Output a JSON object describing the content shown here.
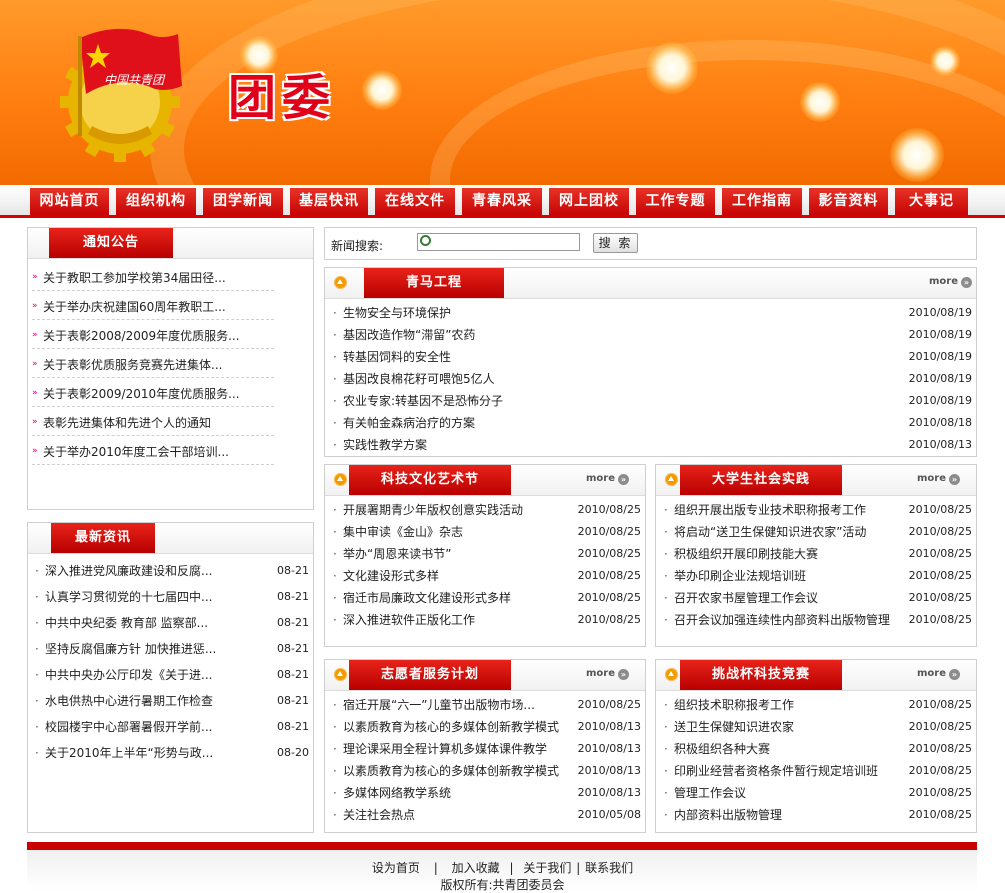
{
  "header": {
    "site_title": "团委"
  },
  "nav": [
    "网站首页",
    "组织机构",
    "团学新闻",
    "基层快讯",
    "在线文件",
    "青春风采",
    "网上团校",
    "工作专题",
    "工作指南",
    "影音资料",
    "大事记"
  ],
  "notice": {
    "title": "通知公告",
    "items": [
      "关于教职工参加学校第34届田径...",
      "关于举办庆祝建国60周年教职工...",
      "关于表彰2008/2009年度优质服务...",
      "关于表彰优质服务竞赛先进集体...",
      "关于表彰2009/2010年度优质服务...",
      "表彰先进集体和先进个人的通知",
      "关于举办2010年度工会干部培训..."
    ]
  },
  "latest": {
    "title": "最新资讯",
    "items": [
      {
        "t": "深入推进党风廉政建设和反腐...",
        "d": "08-21"
      },
      {
        "t": "认真学习贯彻党的十七届四中...",
        "d": "08-21"
      },
      {
        "t": "中共中央纪委 教育部 监察部...",
        "d": "08-21"
      },
      {
        "t": "坚持反腐倡廉方针 加快推进惩...",
        "d": "08-21"
      },
      {
        "t": "中共中央办公厅印发《关于进...",
        "d": "08-21"
      },
      {
        "t": "水电供热中心进行暑期工作检查",
        "d": "08-21"
      },
      {
        "t": "校园楼宇中心部署暑假开学前...",
        "d": "08-21"
      },
      {
        "t": "关于2010年上半年“形势与政...",
        "d": "08-20"
      }
    ]
  },
  "search": {
    "label": "新闻搜索:",
    "button": "搜 索",
    "value": ""
  },
  "more_label": "more",
  "qingma": {
    "title": "青马工程",
    "items": [
      {
        "t": "生物安全与环境保护",
        "d": "2010/08/19"
      },
      {
        "t": "基因改造作物“滞留”农药",
        "d": "2010/08/19"
      },
      {
        "t": "转基因饲料的安全性",
        "d": "2010/08/19"
      },
      {
        "t": "基因改良棉花籽可喂饱5亿人",
        "d": "2010/08/19"
      },
      {
        "t": "农业专家:转基因不是恐怖分子",
        "d": "2010/08/19"
      },
      {
        "t": "有关帕金森病治疗的方案",
        "d": "2010/08/18"
      },
      {
        "t": "实践性教学方案",
        "d": "2010/08/13"
      }
    ]
  },
  "keji": {
    "title": "科技文化艺术节",
    "items": [
      {
        "t": "开展署期青少年版权创意实践活动",
        "d": "2010/08/25"
      },
      {
        "t": "集中审读《金山》杂志",
        "d": "2010/08/25"
      },
      {
        "t": "举办“周恩来读书节”",
        "d": "2010/08/25"
      },
      {
        "t": "文化建设形式多样",
        "d": "2010/08/25"
      },
      {
        "t": "宿迁市局廉政文化建设形式多样",
        "d": "2010/08/25"
      },
      {
        "t": "深入推进软件正版化工作",
        "d": "2010/08/25"
      }
    ]
  },
  "shehui": {
    "title": "大学生社会实践",
    "items": [
      {
        "t": "组织开展出版专业技术职称报考工作",
        "d": "2010/08/25"
      },
      {
        "t": "将启动“送卫生保健知识进农家”活动",
        "d": "2010/08/25"
      },
      {
        "t": "积极组织开展印刷技能大赛",
        "d": "2010/08/25"
      },
      {
        "t": "举办印刷企业法规培训班",
        "d": "2010/08/25"
      },
      {
        "t": "召开农家书屋管理工作会议",
        "d": "2010/08/25"
      },
      {
        "t": "召开会议加强连续性内部资料出版物管理",
        "d": "2010/08/25"
      }
    ]
  },
  "zhiyuan": {
    "title": "志愿者服务计划",
    "items": [
      {
        "t": "宿迁开展“六一”儿童节出版物市场...",
        "d": "2010/08/25"
      },
      {
        "t": "以素质教育为核心的多媒体创新教学模式",
        "d": "2010/08/13"
      },
      {
        "t": "理论课采用全程计算机多媒体课件教学",
        "d": "2010/08/13"
      },
      {
        "t": "以素质教育为核心的多媒体创新教学模式",
        "d": "2010/08/13"
      },
      {
        "t": "多媒体网络教学系统",
        "d": "2010/08/13"
      },
      {
        "t": "关注社会热点",
        "d": "2010/05/08"
      }
    ]
  },
  "tiaozhan": {
    "title": "挑战杯科技竞赛",
    "items": [
      {
        "t": "组织技术职称报考工作",
        "d": "2010/08/25"
      },
      {
        "t": "送卫生保健知识进农家",
        "d": "2010/08/25"
      },
      {
        "t": "积极组织各种大赛",
        "d": "2010/08/25"
      },
      {
        "t": "印刷业经营者资格条件暂行规定培训班",
        "d": "2010/08/25"
      },
      {
        "t": "管理工作会议",
        "d": "2010/08/25"
      },
      {
        "t": "内部资料出版物管理",
        "d": "2010/08/25"
      }
    ]
  },
  "footer": {
    "links": [
      "设为首页",
      "加入收藏",
      "关于我们",
      "联系我们"
    ],
    "separators": [
      "|",
      "|",
      "|"
    ],
    "copyright": "版权所有:共青团委员会"
  }
}
